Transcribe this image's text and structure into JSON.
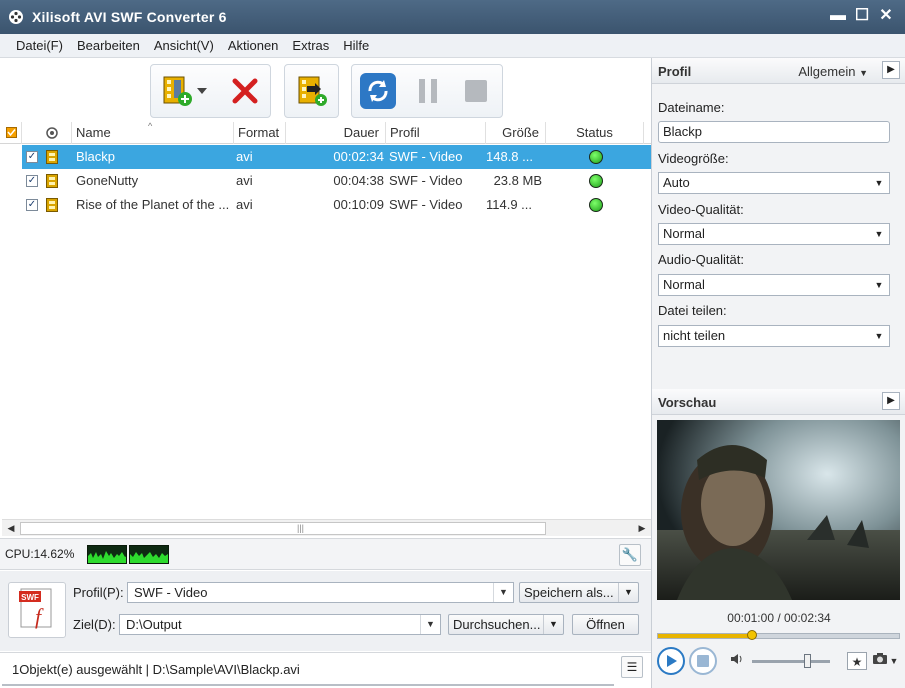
{
  "window": {
    "title": "Xilisoft AVI SWF Converter 6"
  },
  "menu": [
    "Datei(F)",
    "Bearbeiten",
    "Ansicht(V)",
    "Aktionen",
    "Extras",
    "Hilfe"
  ],
  "columns": {
    "name": "Name",
    "format": "Format",
    "dauer": "Dauer",
    "profil": "Profil",
    "groesse": "Größe",
    "status": "Status"
  },
  "files": [
    {
      "name": "Blackp",
      "format": "avi",
      "duration": "00:02:34",
      "profile": "SWF - Video",
      "size": "148.8 ...",
      "checked": true,
      "selected": true
    },
    {
      "name": "GoneNutty",
      "format": "avi",
      "duration": "00:04:38",
      "profile": "SWF - Video",
      "size": "23.8 MB",
      "checked": true,
      "selected": false
    },
    {
      "name": "Rise of the Planet of the ...",
      "format": "avi",
      "duration": "00:10:09",
      "profile": "SWF - Video",
      "size": "114.9 ...",
      "checked": true,
      "selected": false
    }
  ],
  "cpu": {
    "label": "CPU:14.62%"
  },
  "output": {
    "profile_label": "Profil(P):",
    "profile_value": "SWF - Video",
    "save_as": "Speichern als...",
    "dest_label": "Ziel(D):",
    "dest_value": "D:\\Output",
    "browse": "Durchsuchen...",
    "open": "Öffnen"
  },
  "status": {
    "text": "1Objekt(e) ausgewählt | D:\\Sample\\AVI\\Blackp.avi"
  },
  "profile_panel": {
    "title": "Profil",
    "mode": "Allgemein",
    "filename_label": "Dateiname:",
    "filename_value": "Blackp",
    "videosize_label": "Videogröße:",
    "videosize_value": "Auto",
    "videoquality_label": "Video-Qualität:",
    "videoquality_value": "Normal",
    "audioquality_label": "Audio-Qualität:",
    "audioquality_value": "Normal",
    "split_label": "Datei teilen:",
    "split_value": "nicht teilen"
  },
  "preview_panel": {
    "title": "Vorschau",
    "time": "00:01:00 / 00:02:34",
    "progress": 0.39,
    "volume": 0.72
  },
  "colors": {
    "accent": "#3ba6e0",
    "titlebar": "#3f5a76",
    "status_ok": "#22b01a"
  }
}
